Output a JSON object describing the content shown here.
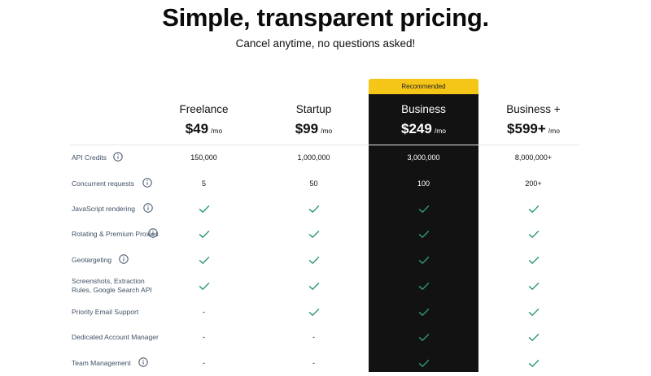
{
  "header": {
    "title": "Simple, transparent pricing.",
    "subtitle": "Cancel anytime, no questions asked!"
  },
  "badge": {
    "label": "Recommended"
  },
  "colors": {
    "accent": "#f5c518",
    "highlight_bg": "#121212",
    "check": "#2f9a6f"
  },
  "plans": [
    {
      "name": "Freelance",
      "price": "$49",
      "unit": "/mo"
    },
    {
      "name": "Startup",
      "price": "$99",
      "unit": "/mo"
    },
    {
      "name": "Business",
      "price": "$249",
      "unit": "/mo"
    },
    {
      "name": "Business +",
      "price": "$599+",
      "unit": "/mo"
    }
  ],
  "features": [
    {
      "label": "API Credits",
      "has_info": true,
      "values": [
        "150,000",
        "1,000,000",
        "3,000,000",
        "8,000,000+"
      ]
    },
    {
      "label": "Concurrent requests",
      "has_info": true,
      "values": [
        "5",
        "50",
        "100",
        "200+"
      ]
    },
    {
      "label": "JavaScript rendering",
      "has_info": true,
      "values": [
        "check",
        "check",
        "check",
        "check"
      ]
    },
    {
      "label": "Rotating & Premium Proxies",
      "has_info": true,
      "values": [
        "check",
        "check",
        "check",
        "check"
      ]
    },
    {
      "label": "Geotargeting",
      "has_info": true,
      "values": [
        "check",
        "check",
        "check",
        "check"
      ]
    },
    {
      "label": "Screenshots, Extraction Rules, Google Search API",
      "has_info": false,
      "values": [
        "check",
        "check",
        "check",
        "check"
      ]
    },
    {
      "label": "Priority Email Support",
      "has_info": false,
      "values": [
        "-",
        "check",
        "check",
        "check"
      ]
    },
    {
      "label": "Dedicated Account Manager",
      "has_info": false,
      "values": [
        "-",
        "-",
        "check",
        "check"
      ]
    },
    {
      "label": "Team Management",
      "has_info": true,
      "values": [
        "-",
        "-",
        "check",
        "check"
      ]
    }
  ]
}
